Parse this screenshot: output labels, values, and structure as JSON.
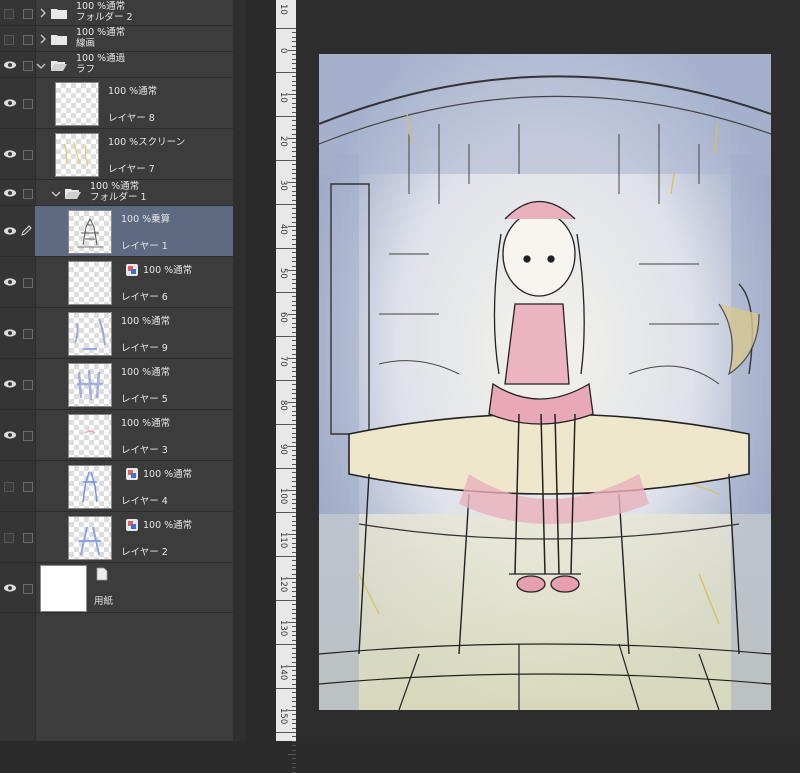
{
  "layers_panel": {
    "rows": [
      {
        "kind": "folder",
        "mode": "100 %通常",
        "name": "フォルダー 2",
        "visible": false,
        "expanded": false
      },
      {
        "kind": "folder",
        "mode": "100 %通常",
        "name": "線画",
        "visible": false,
        "expanded": false
      },
      {
        "kind": "folder",
        "mode": "100 %通過",
        "name": "ラフ",
        "visible": true,
        "expanded": true
      },
      {
        "kind": "layer",
        "mode": "100 %通常",
        "name": "レイヤー 8",
        "visible": true
      },
      {
        "kind": "layer",
        "mode": "100 %スクリーン",
        "name": "レイヤー 7",
        "visible": true
      },
      {
        "kind": "folder",
        "mode": "100 %通常",
        "name": "フォルダー 1",
        "visible": true,
        "expanded": true
      },
      {
        "kind": "layer",
        "mode": "100 %乗算",
        "name": "レイヤー 1",
        "visible": true,
        "selected": true
      },
      {
        "kind": "layer",
        "mode": "100 %通常",
        "name": "レイヤー 6",
        "visible": true,
        "clip": true
      },
      {
        "kind": "layer",
        "mode": "100 %通常",
        "name": "レイヤー 9",
        "visible": true
      },
      {
        "kind": "layer",
        "mode": "100 %通常",
        "name": "レイヤー 5",
        "visible": true
      },
      {
        "kind": "layer",
        "mode": "100 %通常",
        "name": "レイヤー 3",
        "visible": true
      },
      {
        "kind": "layer",
        "mode": "100 %通常",
        "name": "レイヤー 4",
        "visible": false,
        "clip": true
      },
      {
        "kind": "layer",
        "mode": "100 %通常",
        "name": "レイヤー 2",
        "visible": false,
        "clip": true
      },
      {
        "kind": "paper",
        "name": "用紙",
        "visible": true
      }
    ]
  },
  "ruler": {
    "labels": [
      "10",
      "0",
      "10",
      "20",
      "30",
      "40",
      "50",
      "60",
      "70",
      "80",
      "90",
      "100",
      "110",
      "120",
      "130",
      "140",
      "150"
    ]
  },
  "colors": {
    "panel_bg": "#3c3c3c",
    "selected_row": "#5e6a82",
    "canvas_blue": "#9aa8c8",
    "canvas_yellow": "#e6dca0",
    "canvas_pink": "#e8a8b8"
  }
}
